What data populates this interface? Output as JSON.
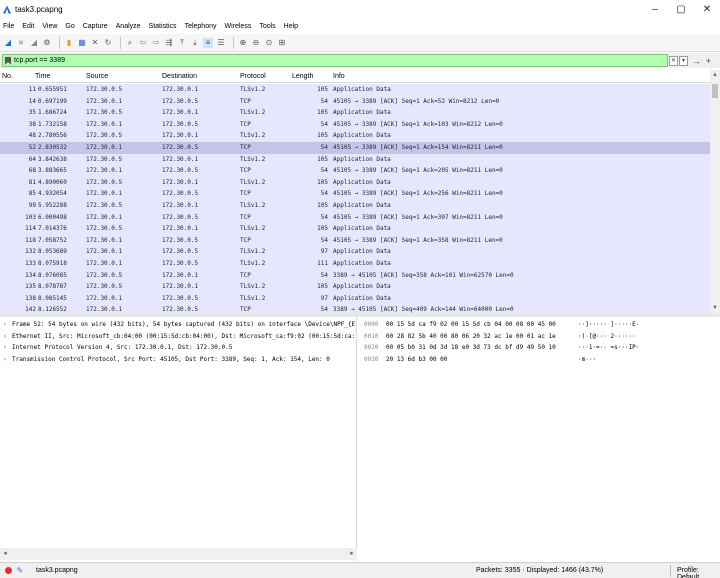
{
  "window": {
    "title": "task3.pcapng",
    "minimize_glyph": "–",
    "maximize_glyph": "▢",
    "close_glyph": "✕"
  },
  "menu": [
    "File",
    "Edit",
    "View",
    "Go",
    "Capture",
    "Analyze",
    "Statistics",
    "Telephony",
    "Wireless",
    "Tools",
    "Help"
  ],
  "toolbar": {
    "icons": [
      "shark-fin-start-icon",
      "stop-icon",
      "restart-icon",
      "options-gear-icon",
      "open-file-icon",
      "save-icon",
      "close-file-icon",
      "reload-icon",
      "find-icon",
      "back-icon",
      "forward-icon",
      "goto-packet-icon",
      "first-packet-icon",
      "last-packet-icon",
      "autoscroll-icon",
      "colorize-icon",
      "zoom-in-icon",
      "zoom-out-icon",
      "zoom-reset-icon",
      "resize-columns-icon"
    ]
  },
  "filter": {
    "value": "tcp.port == 3389",
    "clear_glyph": "✕",
    "dropdown_glyph": "▾",
    "apply_glyph": "→",
    "add_glyph": "+"
  },
  "packet_list": {
    "columns": [
      "No.",
      "Time",
      "Source",
      "Destination",
      "Protocol",
      "Length",
      "Info"
    ],
    "selected_no": "52",
    "rows": [
      {
        "no": "11",
        "time": "0.655951",
        "src": "172.30.0.5",
        "dst": "172.30.0.1",
        "proto": "TLSv1.2",
        "len": "105",
        "info": "Application Data"
      },
      {
        "no": "14",
        "time": "0.697199",
        "src": "172.30.0.1",
        "dst": "172.30.0.5",
        "proto": "TCP",
        "len": "54",
        "info": "45105 → 3389 [ACK] Seq=1 Ack=52 Win=8212 Len=0"
      },
      {
        "no": "35",
        "time": "1.686724",
        "src": "172.30.0.5",
        "dst": "172.30.0.1",
        "proto": "TLSv1.2",
        "len": "105",
        "info": "Application Data"
      },
      {
        "no": "38",
        "time": "1.732158",
        "src": "172.30.0.1",
        "dst": "172.30.0.5",
        "proto": "TCP",
        "len": "54",
        "info": "45105 → 3389 [ACK] Seq=1 Ack=103 Win=8212 Len=0"
      },
      {
        "no": "48",
        "time": "2.780556",
        "src": "172.30.0.5",
        "dst": "172.30.0.1",
        "proto": "TLSv1.2",
        "len": "105",
        "info": "Application Data"
      },
      {
        "no": "52",
        "time": "2.830532",
        "src": "172.30.0.1",
        "dst": "172.30.0.5",
        "proto": "TCP",
        "len": "54",
        "info": "45105 → 3389 [ACK] Seq=1 Ack=154 Win=8211 Len=0"
      },
      {
        "no": "64",
        "time": "3.842638",
        "src": "172.30.0.5",
        "dst": "172.30.0.1",
        "proto": "TLSv1.2",
        "len": "105",
        "info": "Application Data"
      },
      {
        "no": "68",
        "time": "3.883665",
        "src": "172.30.0.1",
        "dst": "172.30.0.5",
        "proto": "TCP",
        "len": "54",
        "info": "45105 → 3389 [ACK] Seq=1 Ack=205 Win=8211 Len=0"
      },
      {
        "no": "81",
        "time": "4.890060",
        "src": "172.30.0.5",
        "dst": "172.30.0.1",
        "proto": "TLSv1.2",
        "len": "105",
        "info": "Application Data"
      },
      {
        "no": "85",
        "time": "4.932054",
        "src": "172.30.0.1",
        "dst": "172.30.0.5",
        "proto": "TCP",
        "len": "54",
        "info": "45105 → 3389 [ACK] Seq=1 Ack=256 Win=8211 Len=0"
      },
      {
        "no": "99",
        "time": "5.952288",
        "src": "172.30.0.5",
        "dst": "172.30.0.1",
        "proto": "TLSv1.2",
        "len": "105",
        "info": "Application Data"
      },
      {
        "no": "103",
        "time": "6.000498",
        "src": "172.30.0.1",
        "dst": "172.30.0.5",
        "proto": "TCP",
        "len": "54",
        "info": "45105 → 3389 [ACK] Seq=1 Ack=307 Win=8211 Len=0"
      },
      {
        "no": "114",
        "time": "7.014376",
        "src": "172.30.0.5",
        "dst": "172.30.0.1",
        "proto": "TLSv1.2",
        "len": "105",
        "info": "Application Data"
      },
      {
        "no": "118",
        "time": "7.058752",
        "src": "172.30.0.1",
        "dst": "172.30.0.5",
        "proto": "TCP",
        "len": "54",
        "info": "45105 → 3389 [ACK] Seq=1 Ack=358 Win=8211 Len=0"
      },
      {
        "no": "132",
        "time": "8.053689",
        "src": "172.30.0.1",
        "dst": "172.30.0.5",
        "proto": "TLSv1.2",
        "len": "97",
        "info": "Application Data"
      },
      {
        "no": "133",
        "time": "8.075918",
        "src": "172.30.0.1",
        "dst": "172.30.0.5",
        "proto": "TLSv1.2",
        "len": "111",
        "info": "Application Data"
      },
      {
        "no": "134",
        "time": "8.076085",
        "src": "172.30.0.5",
        "dst": "172.30.0.1",
        "proto": "TCP",
        "len": "54",
        "info": "3389 → 45105 [ACK] Seq=358 Ack=101 Win=62570 Len=0"
      },
      {
        "no": "135",
        "time": "8.078787",
        "src": "172.30.0.5",
        "dst": "172.30.0.1",
        "proto": "TLSv1.2",
        "len": "105",
        "info": "Application Data"
      },
      {
        "no": "138",
        "time": "8.085145",
        "src": "172.30.0.1",
        "dst": "172.30.0.5",
        "proto": "TLSv1.2",
        "len": "97",
        "info": "Application Data"
      },
      {
        "no": "142",
        "time": "8.126552",
        "src": "172.30.0.1",
        "dst": "172.30.0.5",
        "proto": "TCP",
        "len": "54",
        "info": "3389 → 45105 [ACK] Seq=409 Ack=144 Win=64000 Len=0"
      }
    ]
  },
  "details": [
    "Frame 52: 54 bytes on wire (432 bits), 54 bytes captured (432 bits) on interface \\Device\\NPF_{E",
    "Ethernet II, Src: Microsoft_cb:04:00 (00:15:5d:cb:04:00), Dst: Microsoft_ca:f9:02 (00:15:5d:ca:",
    "Internet Protocol Version 4, Src: 172.30.0.1, Dst: 172.30.0.5",
    "Transmission Control Protocol, Src Port: 45105, Dst Port: 3389, Seq: 1, Ack: 154, Len: 0"
  ],
  "bytes": [
    {
      "offset": "0000",
      "hex": "00 15 5d ca f9 02 00 15  5d cb 04 00 08 00 45 00",
      "ascii": "··]·····  ]·····E·"
    },
    {
      "offset": "0010",
      "hex": "00 28 82 5b 40 00 80 06  20 32 ac 1e 00 01 ac 1e",
      "ascii": "·(·[@···  2······"
    },
    {
      "offset": "0020",
      "hex": "00 05 b0 31 0d 3d 18 e0  3d 73 dc bf d9 49 50 10",
      "ascii": "···1·=··  =s···IP·"
    },
    {
      "offset": "0030",
      "hex": "20 13 6d b3 00 00",
      "ascii": " ·m···"
    }
  ],
  "status": {
    "file": "task3.pcapng",
    "stats": "Packets: 3355 · Displayed: 1466 (43.7%)",
    "profile": "Profile: Default"
  }
}
